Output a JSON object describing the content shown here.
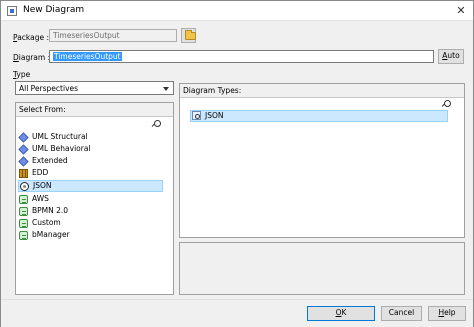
{
  "window": {
    "title": "New Diagram",
    "close_glyph": "✕"
  },
  "form": {
    "package_label_prefix": "P",
    "package_label_rest": "ackage :",
    "package_value": "TimeseriesOutput",
    "diagram_label_rest": "iagram :",
    "diagram_label_prefix": "D",
    "diagram_value": "TimeseriesOutput",
    "auto_button_prefix": "A",
    "auto_button_rest": "uto"
  },
  "type_section": {
    "label_prefix": "T",
    "label_rest": "ype",
    "perspective_selected": "All Perspectives"
  },
  "select_from": {
    "header": "Select From:",
    "items": [
      {
        "label": "UML Structural",
        "icon": "uml-icon"
      },
      {
        "label": "UML Behavioral",
        "icon": "uml-icon"
      },
      {
        "label": "Extended",
        "icon": "uml-icon"
      },
      {
        "label": "EDD",
        "icon": "edd-icon"
      },
      {
        "label": "JSON",
        "icon": "json-icon",
        "selected": true
      },
      {
        "label": "AWS",
        "icon": "toolbox-icon"
      },
      {
        "label": "BPMN 2.0",
        "icon": "toolbox-icon"
      },
      {
        "label": "Custom",
        "icon": "toolbox-icon"
      },
      {
        "label": "bManager",
        "icon": "toolbox-icon"
      }
    ]
  },
  "diagram_types": {
    "header": "Diagram Types:",
    "items": [
      {
        "label": "JSON",
        "icon": "json-diagram-icon",
        "selected": true
      }
    ]
  },
  "footer": {
    "ok_prefix": "O",
    "ok_rest": "K",
    "cancel_label": "Cancel",
    "help_prefix": "H",
    "help_rest": "elp"
  }
}
